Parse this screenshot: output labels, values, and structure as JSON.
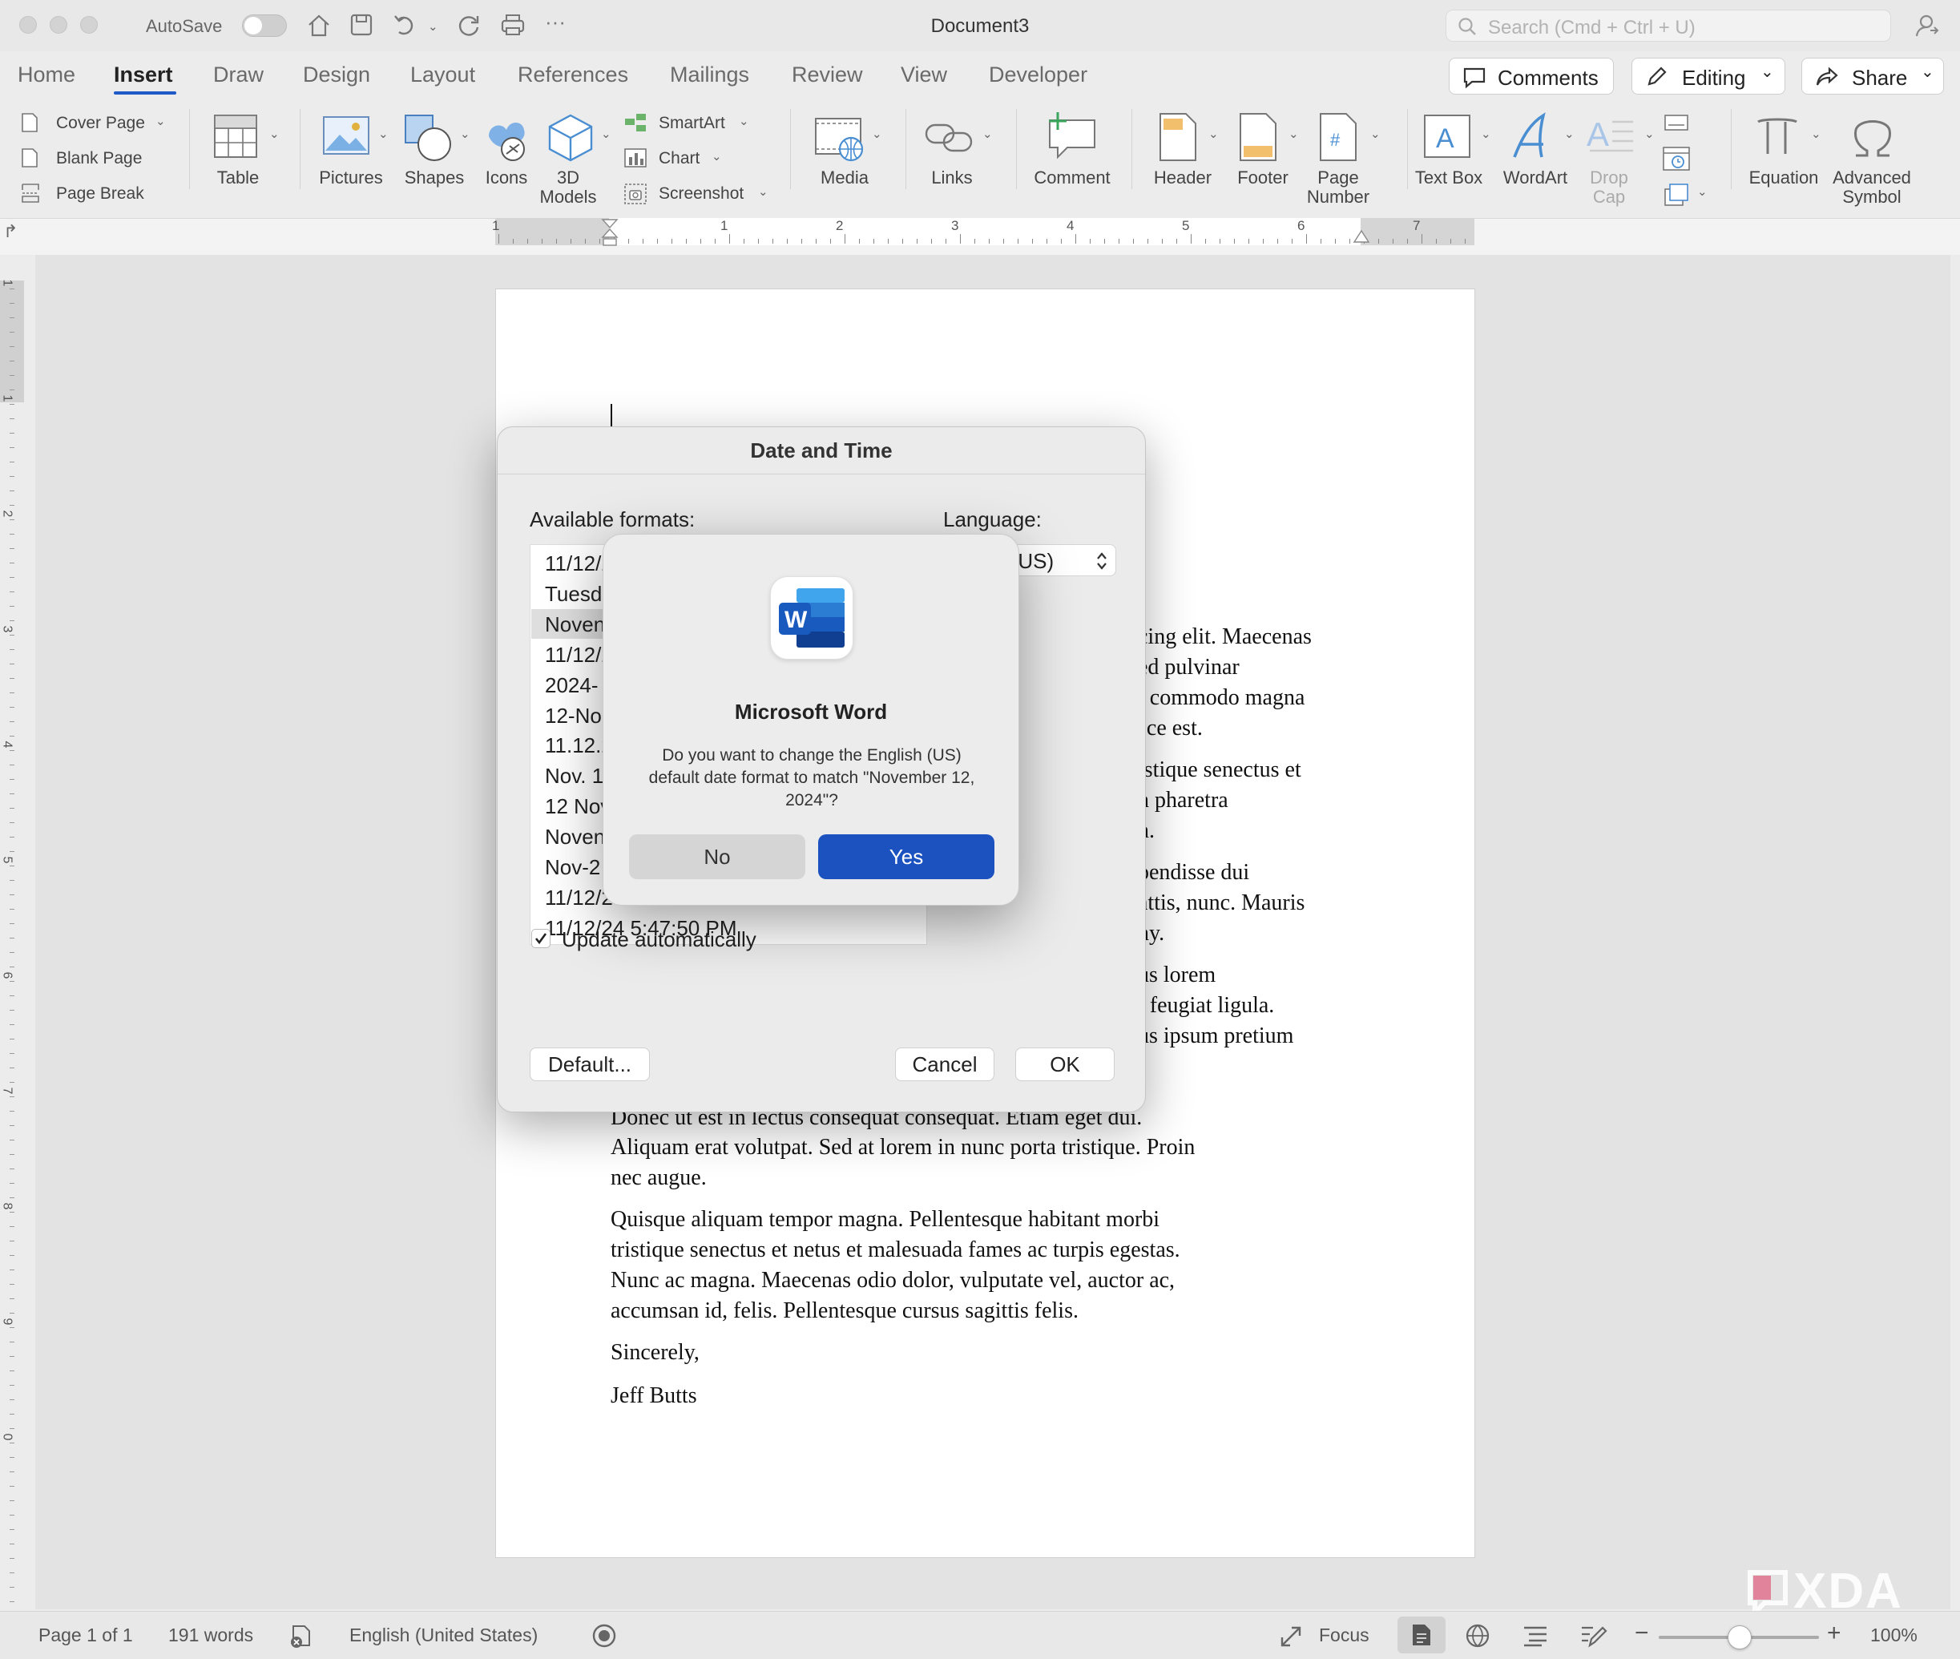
{
  "window": {
    "title": "Document3",
    "autosave_label": "AutoSave",
    "search_placeholder": "Search (Cmd + Ctrl + U)"
  },
  "tabs": [
    "Home",
    "Insert",
    "Draw",
    "Design",
    "Layout",
    "References",
    "Mailings",
    "Review",
    "View",
    "Developer"
  ],
  "active_tab": "Insert",
  "header_buttons": {
    "comments": "Comments",
    "editing": "Editing",
    "share": "Share"
  },
  "ribbon": {
    "pages": [
      "Cover Page",
      "Blank Page",
      "Page Break"
    ],
    "table": "Table",
    "pictures": "Pictures",
    "shapes": "Shapes",
    "icons": "Icons",
    "models_3d": [
      "3D",
      "Models"
    ],
    "smartart": "SmartArt",
    "chart": "Chart",
    "screenshot": "Screenshot",
    "media": "Media",
    "links": "Links",
    "comment": "Comment",
    "header": "Header",
    "footer": "Footer",
    "page_number": [
      "Page",
      "Number"
    ],
    "text_box": "Text Box",
    "wordart": "WordArt",
    "drop_cap": [
      "Drop",
      "Cap"
    ],
    "equation": "Equation",
    "advanced_symbol": [
      "Advanced",
      "Symbol"
    ]
  },
  "ruler": {
    "numbers": [
      "1",
      "1",
      "2",
      "3",
      "4",
      "5",
      "6",
      "7"
    ],
    "vertical_numbers": [
      "1",
      "1",
      "2",
      "3",
      "4",
      "5",
      "6",
      "7",
      "8",
      "9",
      "0"
    ]
  },
  "document": {
    "right_fragments": [
      "cing elit. Maecenas",
      "ed pulvinar",
      "t commodo magna",
      "sce est.",
      "istique senectus et",
      "n pharetra",
      "n.",
      "pendisse dui",
      "attis, nunc. Mauris",
      "ny.",
      "us lorem",
      "t feugiat ligula.",
      "us ipsum pretium"
    ],
    "partial_line": "Donec ut est in lectus consequat consequat. Etiam eget dui.",
    "lines": [
      "Aliquam erat volutpat. Sed at lorem in nunc porta tristique. Proin",
      "nec augue.",
      "Quisque aliquam tempor magna. Pellentesque habitant morbi",
      "tristique senectus et netus et malesuada fames ac turpis egestas.",
      "Nunc ac magna. Maecenas odio dolor, vulputate vel, auctor ac,",
      "accumsan id, felis. Pellentesque cursus sagittis felis.",
      "Sincerely,",
      "Jeff Butts"
    ]
  },
  "dialog": {
    "title": "Date and Time",
    "formats_label": "Available formats:",
    "language_label": "Language:",
    "language_value": "h (US)",
    "formats": [
      "11/12/2",
      "Tuesd",
      "Noven",
      "11/12/2",
      "2024-",
      "12-No",
      "11.12.2",
      "Nov. 1",
      "12 Nov",
      "Noven",
      "Nov-2",
      "11/12/2",
      "11/12/24 5:47:50 PM"
    ],
    "selected_index": 2,
    "update_auto_label": "Update automatically",
    "update_auto_checked": true,
    "default_button": "Default...",
    "cancel_button": "Cancel",
    "ok_button": "OK"
  },
  "alert": {
    "app_name": "Microsoft Word",
    "message": "Do you want to change the English (US) default date format to match \"November 12, 2024\"?",
    "no_button": "No",
    "yes_button": "Yes"
  },
  "status_bar": {
    "page": "Page 1 of 1",
    "words": "191 words",
    "language": "English (United States)",
    "focus": "Focus",
    "zoom": "100%"
  },
  "watermark": "XDA",
  "colors": {
    "accent": "#1c52c0",
    "tab_underline": "#1f59c7",
    "word_blue": "#185abd"
  }
}
